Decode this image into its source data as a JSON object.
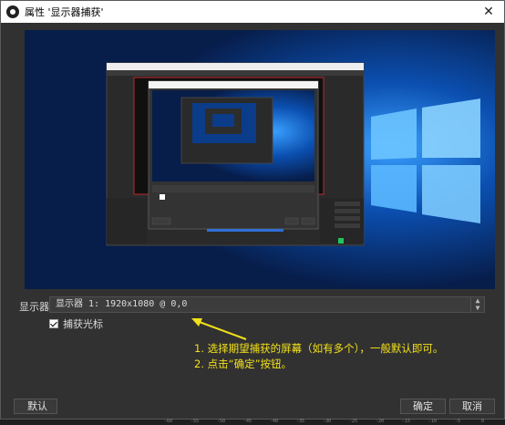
{
  "window": {
    "title": "属性 '显示器捕获'",
    "close_glyph": "✕"
  },
  "preview": {
    "nested_window_title": "属性 '显示器捕获'"
  },
  "display_field": {
    "label": "显示器",
    "value": "显示器 1: 1920x1080 @ 0,0"
  },
  "capture_cursor": {
    "label": "捕获光标",
    "checked": true
  },
  "annotation": {
    "line1": "1. 选择期望捕获的屏幕（如有多个），一般默认即可。",
    "line2": "2. 点击“确定”按钮。",
    "color": "#f2e11a"
  },
  "buttons": {
    "default_label": "默认",
    "ok_label": "确定",
    "cancel_label": "取消"
  },
  "ruler": {
    "ticks": [
      "-60",
      "-55",
      "-50",
      "-45",
      "-40",
      "-35",
      "-30",
      "-25",
      "-20",
      "-15",
      "-10",
      "-5",
      "0"
    ]
  }
}
